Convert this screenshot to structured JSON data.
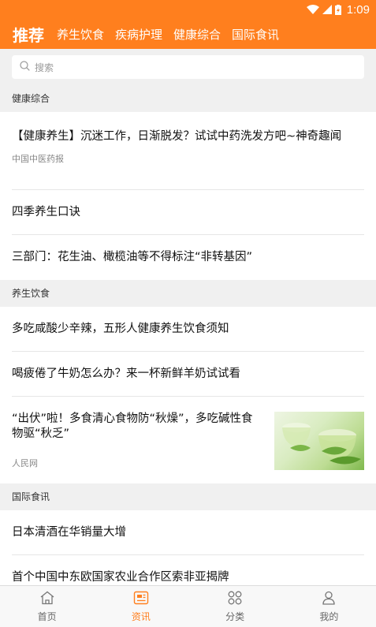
{
  "status": {
    "time": "1:09"
  },
  "tabs": [
    {
      "label": "推荐"
    },
    {
      "label": "养生饮食"
    },
    {
      "label": "疾病护理"
    },
    {
      "label": "健康综合"
    },
    {
      "label": "国际食讯"
    }
  ],
  "search": {
    "placeholder": "搜索"
  },
  "sections": [
    {
      "header": "健康综合",
      "items": [
        {
          "title": "【健康养生】沉迷工作，日渐脱发？试试中药洗发方吧~神奇趣闻",
          "source": "中国中医药报"
        },
        {
          "title": "四季养生口诀"
        },
        {
          "title": "三部门：花生油、橄榄油等不得标注“非转基因”"
        }
      ]
    },
    {
      "header": "养生饮食",
      "items": [
        {
          "title": "多吃咸酸少辛辣，五形人健康养生饮食须知"
        },
        {
          "title": "喝疲倦了牛奶怎么办？来一杯新鲜羊奶试试看"
        },
        {
          "title": "“出伏”啦！多食清心食物防“秋燥”，多吃碱性食物驱“秋乏”",
          "source": "人民网"
        }
      ]
    },
    {
      "header": "国际食讯",
      "items": [
        {
          "title": "日本清酒在华销量大增"
        },
        {
          "title": "首个中国中东欧国家农业合作区索非亚揭牌"
        }
      ]
    }
  ],
  "bottom_nav": [
    {
      "label": "首页",
      "icon": "home-icon"
    },
    {
      "label": "资讯",
      "icon": "news-icon"
    },
    {
      "label": "分类",
      "icon": "category-icon"
    },
    {
      "label": "我的",
      "icon": "profile-icon"
    }
  ],
  "colors": {
    "accent": "#ff7f1e"
  }
}
